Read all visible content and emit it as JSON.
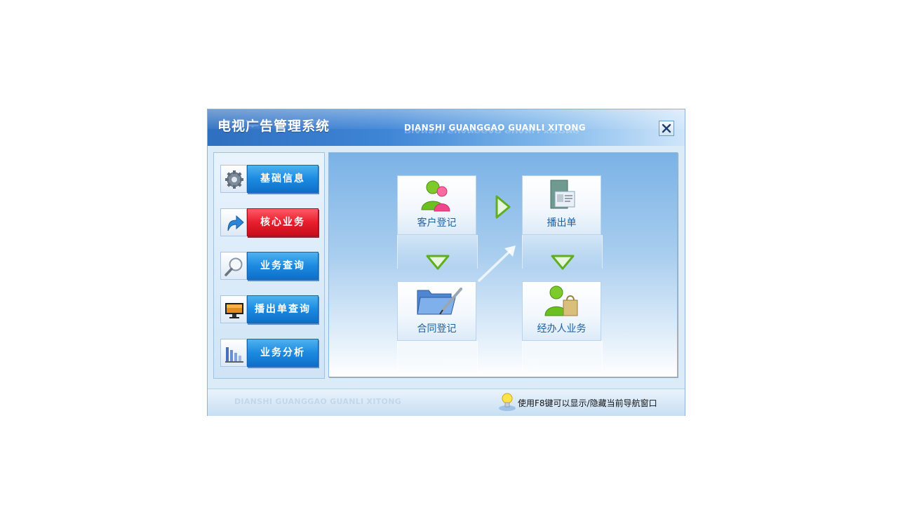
{
  "window": {
    "title": "电视广告管理系统",
    "subtitle": "DIANSHI GUANGGAO GUANLI XITONG",
    "close_icon": "close-icon"
  },
  "sidebar": {
    "items": [
      {
        "label": "基础信息",
        "icon": "gear-icon",
        "active": false
      },
      {
        "label": "核心业务",
        "icon": "curved-arrow-icon",
        "active": true
      },
      {
        "label": "业务查询",
        "icon": "magnifier-icon",
        "active": false
      },
      {
        "label": "播出单查询",
        "icon": "monitor-icon",
        "active": false
      },
      {
        "label": "业务分析",
        "icon": "bar-chart-icon",
        "active": false
      }
    ]
  },
  "workflow": {
    "tiles": [
      {
        "label": "客户登记",
        "icon": "users-icon"
      },
      {
        "label": "播出单",
        "icon": "document-card-icon"
      },
      {
        "label": "合同登记",
        "icon": "folder-pen-icon"
      },
      {
        "label": "经办人业务",
        "icon": "user-bag-icon"
      }
    ]
  },
  "statusbar": {
    "watermark": "DIANSHI GUANGGAO GUANLI XITONG",
    "hint": "使用F8键可以显示/隐藏当前导航窗口",
    "hint_icon": "lightbulb-icon"
  },
  "colors": {
    "title_bar": "#3f86d6",
    "nav_button": "#1c8ae0",
    "nav_button_active": "#e81e2d",
    "flow_arrow": "#5fae1e",
    "tile_caption": "#1f5f9e"
  }
}
